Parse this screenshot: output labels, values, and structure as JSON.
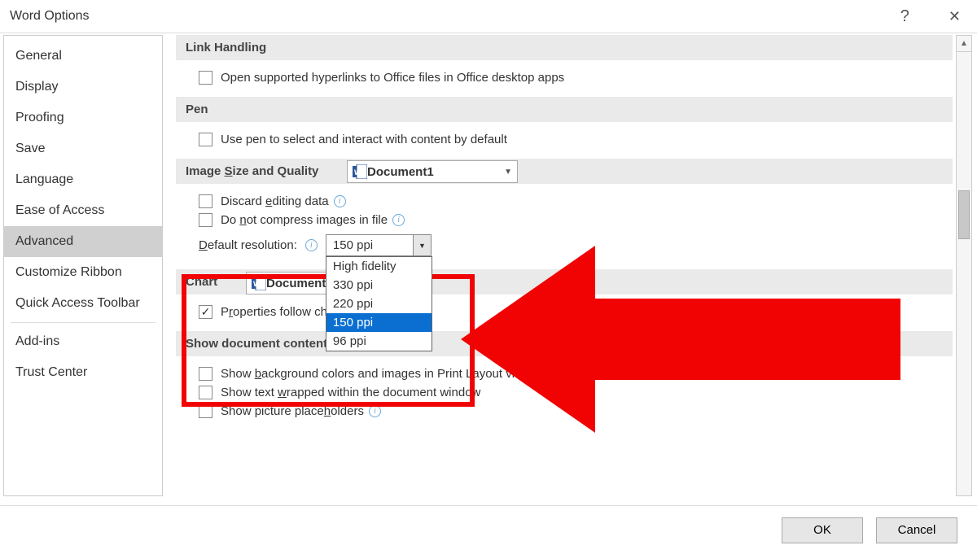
{
  "title": "Word Options",
  "sidebar": [
    {
      "label": "General"
    },
    {
      "label": "Display"
    },
    {
      "label": "Proofing"
    },
    {
      "label": "Save"
    },
    {
      "label": "Language"
    },
    {
      "label": "Ease of Access"
    },
    {
      "label": "Advanced",
      "selected": true
    },
    {
      "label": "Customize Ribbon"
    },
    {
      "label": "Quick Access Toolbar"
    },
    {
      "sep": true
    },
    {
      "label": "Add-ins"
    },
    {
      "label": "Trust Center"
    }
  ],
  "sections": {
    "link": {
      "title": "Link Handling",
      "open_hyperlinks": "Open supported hyperlinks to Office files in Office desktop apps"
    },
    "pen": {
      "title": "Pen",
      "use_pen": "Use pen to select and interact with content by default"
    },
    "image": {
      "title_pre": "Image ",
      "title_u": "S",
      "title_post": "ize and Quality",
      "doc_name": "Document1",
      "discard_pre": "Discard ",
      "discard_u": "e",
      "discard_post": "diting data",
      "no_compress_pre": "Do ",
      "no_compress_u": "n",
      "no_compress_post": "ot compress images in file",
      "res_label_pre": "",
      "res_label_u": "D",
      "res_label_post": "efault resolution:",
      "res_value": "150 ppi",
      "res_options": [
        "High fidelity",
        "330 ppi",
        "220 ppi",
        "150 ppi",
        "96 ppi"
      ],
      "res_selected_index": 3
    },
    "chart": {
      "title": "Chart",
      "doc_name": "Document1",
      "props_pre": "P",
      "props_u": "r",
      "props_post": "operties follow chart data point"
    },
    "show": {
      "title": "Show document content",
      "bg_pre": "Show ",
      "bg_u": "b",
      "bg_post": "ackground colors and images in Print Layout view",
      "wrap_pre": "Show text ",
      "wrap_u": "w",
      "wrap_post": "rapped within the document window",
      "pic_pre": "Show picture place",
      "pic_u": "h",
      "pic_post": "olders"
    }
  },
  "buttons": {
    "ok": "OK",
    "cancel": "Cancel"
  }
}
